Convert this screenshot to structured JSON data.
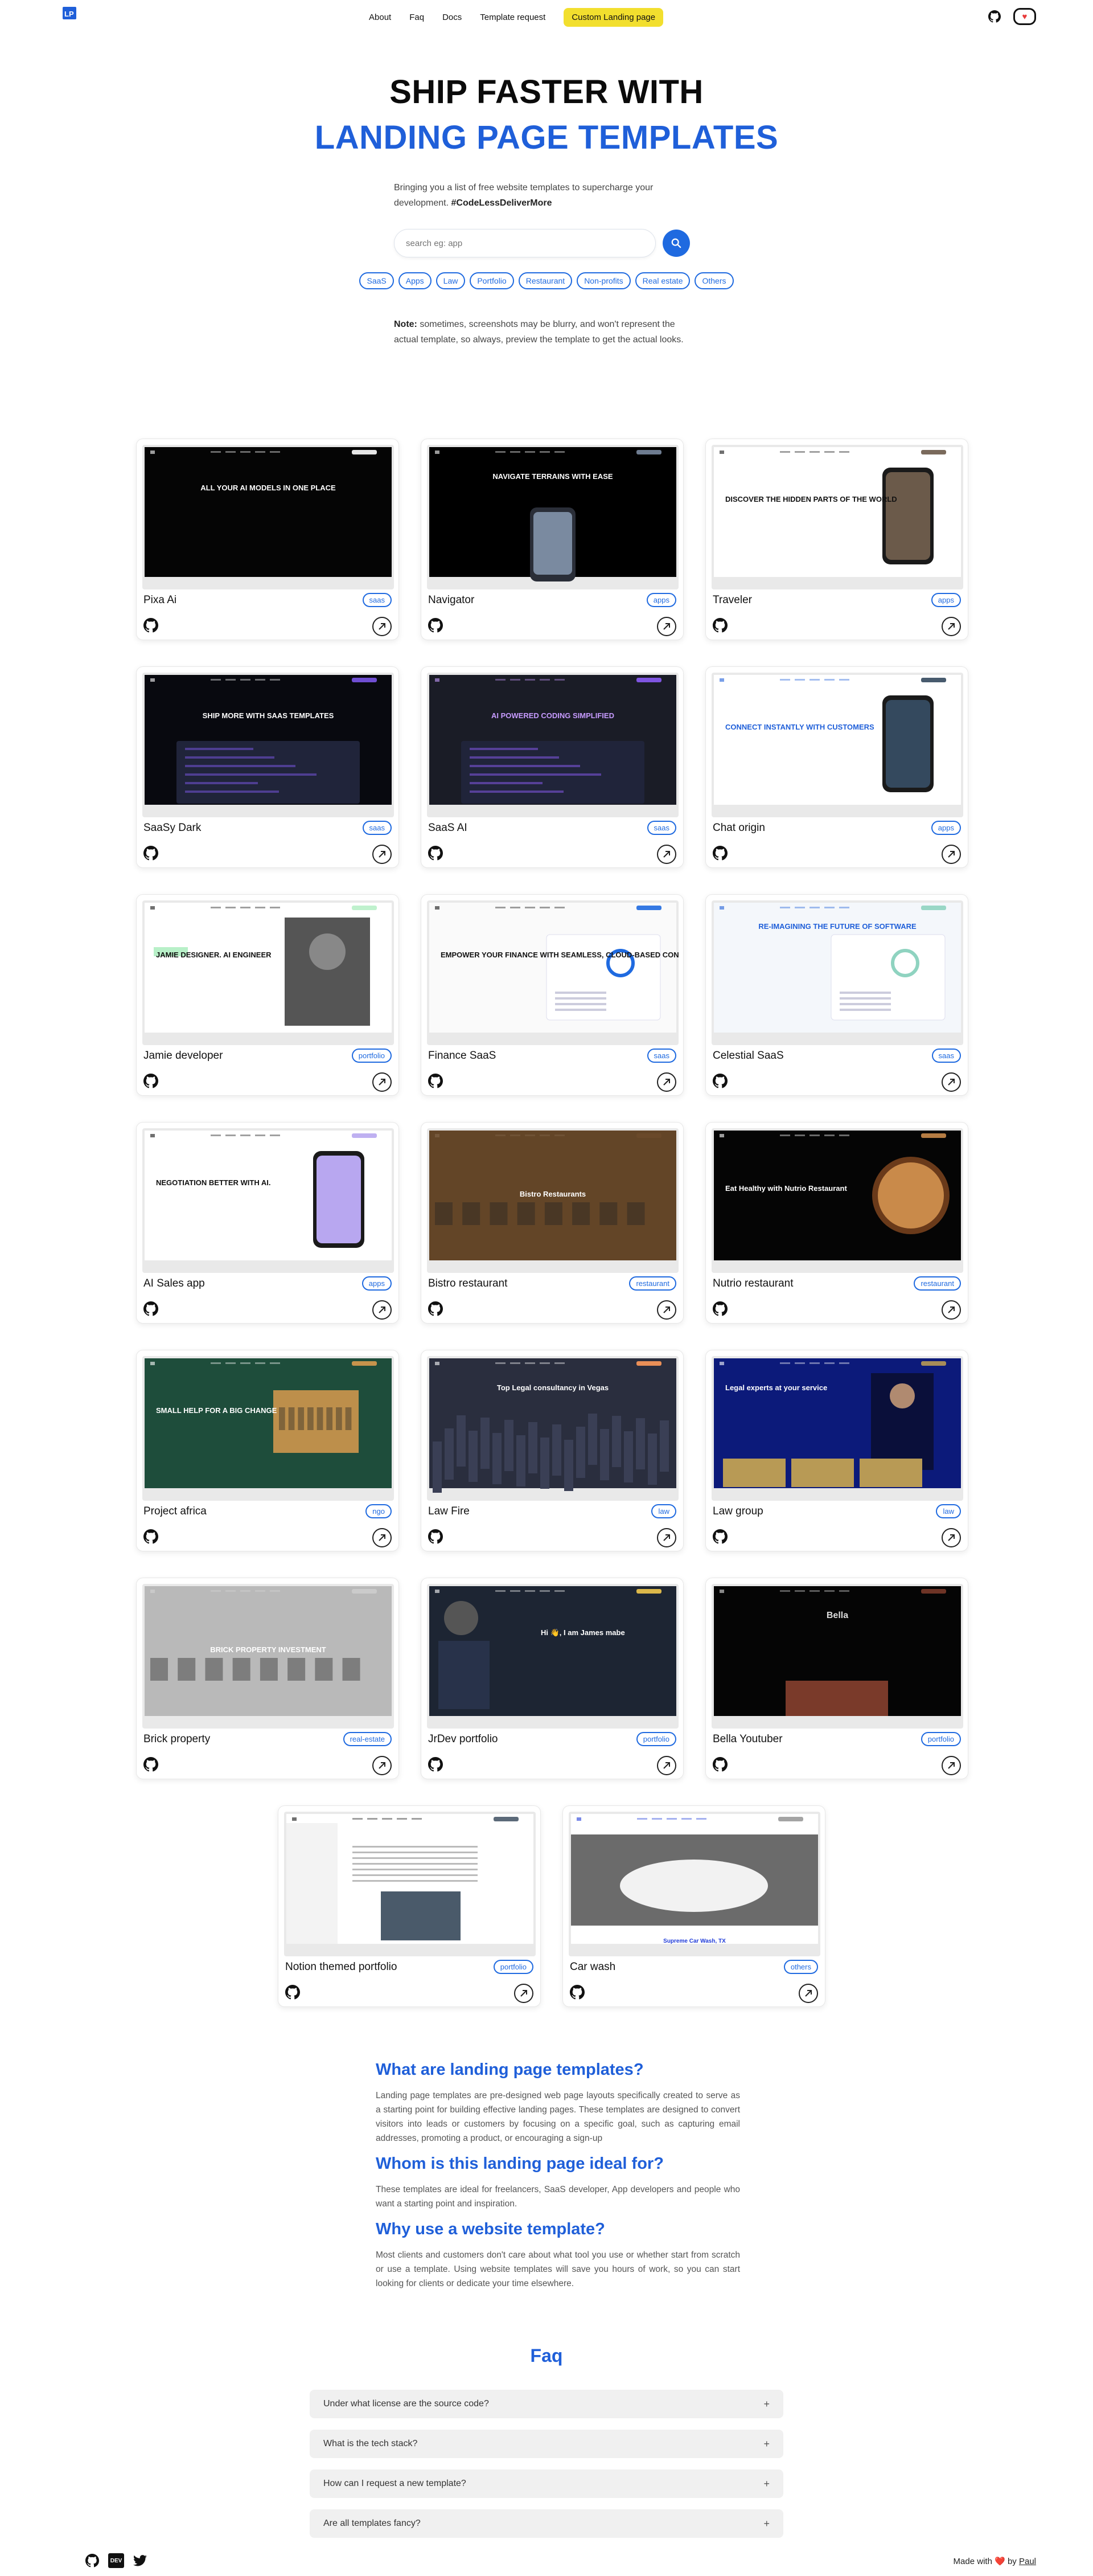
{
  "header": {
    "logo_text": "LP",
    "nav": [
      {
        "label": "About"
      },
      {
        "label": "Faq"
      },
      {
        "label": "Docs"
      },
      {
        "label": "Template request"
      }
    ],
    "cta_label": "Custom Landing page",
    "icons": [
      "github-icon",
      "kofi-icon"
    ]
  },
  "hero": {
    "title_line1": "SHIP FASTER WITH",
    "title_line2": "LANDING PAGE TEMPLATES",
    "subtitle": "Bringing you a list of free website templates to supercharge your development.",
    "hashtag": "#CodeLessDeliverMore",
    "search_placeholder": "search eg: app",
    "categories": [
      "SaaS",
      "Apps",
      "Law",
      "Portfolio",
      "Restaurant",
      "Non-profits",
      "Real estate",
      "Others"
    ],
    "note_label": "Note:",
    "note_text": "sometimes, screenshots may be blurry, and won't represent the actual template, so always, preview the template to get the actual looks."
  },
  "templates": [
    {
      "title": "Pixa Ai",
      "tag": "saas",
      "thumb_text": "ALL YOUR AI MODELS IN ONE PLACE"
    },
    {
      "title": "Navigator",
      "tag": "apps",
      "thumb_text": "NAVIGATE TERRAINS WITH EASE"
    },
    {
      "title": "Traveler",
      "tag": "apps",
      "thumb_text": "DISCOVER THE HIDDEN PARTS OF THE WORLD"
    },
    {
      "title": "SaaSy Dark",
      "tag": "saas",
      "thumb_text": "SHIP MORE WITH SAAS TEMPLATES"
    },
    {
      "title": "SaaS AI",
      "tag": "saas",
      "thumb_text": "AI POWERED CODING SIMPLIFIED"
    },
    {
      "title": "Chat origin",
      "tag": "apps",
      "thumb_text": "CONNECT INSTANTLY WITH CUSTOMERS"
    },
    {
      "title": "Jamie developer",
      "tag": "portfolio",
      "thumb_text": "JAMIE DESIGNER. AI ENGINEER"
    },
    {
      "title": "Finance SaaS",
      "tag": "saas",
      "thumb_text": "EMPOWER YOUR FINANCE WITH SEAMLESS, CLOUD-BASED CONTROL."
    },
    {
      "title": "Celestial SaaS",
      "tag": "saas",
      "thumb_text": "RE-IMAGINING THE FUTURE OF SOFTWARE"
    },
    {
      "title": "AI Sales app",
      "tag": "apps",
      "thumb_text": "NEGOTIATION BETTER WITH AI."
    },
    {
      "title": "Bistro restaurant",
      "tag": "restaurant",
      "thumb_text": "Bistro Restaurants"
    },
    {
      "title": "Nutrio restaurant",
      "tag": "restaurant",
      "thumb_text": "Eat Healthy with Nutrio Restaurant"
    },
    {
      "title": "Project africa",
      "tag": "ngo",
      "thumb_text": "SMALL HELP FOR A BIG CHANGE"
    },
    {
      "title": "Law Fire",
      "tag": "law",
      "thumb_text": "Top Legal consultancy in Vegas"
    },
    {
      "title": "Law group",
      "tag": "law",
      "thumb_text": "Legal experts at your service"
    },
    {
      "title": "Brick property",
      "tag": "real-estate",
      "thumb_text": "BRICK PROPERTY INVESTMENT"
    },
    {
      "title": "JrDev portfolio",
      "tag": "portfolio",
      "thumb_text": "Hi 👋, I am James mabe"
    },
    {
      "title": "Bella Youtuber",
      "tag": "portfolio",
      "thumb_text": "Bella"
    },
    {
      "title": "Notion themed portfolio",
      "tag": "portfolio",
      "thumb_text": ""
    },
    {
      "title": "Car wash",
      "tag": "others",
      "thumb_text": "Supreme Car Wash, TX"
    }
  ],
  "info": [
    {
      "heading": "What are landing page templates?",
      "body": "Landing page templates are pre-designed web page layouts specifically created to serve as a starting point for building effective landing pages. These templates are designed to convert visitors into leads or customers by focusing on a specific goal, such as capturing email addresses, promoting a product, or encouraging a sign-up"
    },
    {
      "heading": "Whom is this landing page ideal for?",
      "body": "These templates are ideal for freelancers, SaaS developer, App developers and people who want a starting point and inspiration."
    },
    {
      "heading": "Why use a website template?",
      "body": "Most clients and customers don't care about what tool you use or whether start from scratch or use a template. Using website templates will save you hours of work, so you can start looking for clients or dedicate your time elsewhere."
    }
  ],
  "faq": {
    "title": "Faq",
    "items": [
      {
        "question": "Under what license are the source code?",
        "symbol": "+"
      },
      {
        "question": "What is the tech stack?",
        "symbol": "+"
      },
      {
        "question": "How can I request a new template?",
        "symbol": "+"
      },
      {
        "question": "Are all templates fancy?",
        "symbol": "+"
      }
    ]
  },
  "footer": {
    "icons": [
      "github-icon",
      "dev-icon",
      "twitter-icon"
    ],
    "dev_label": "DEV",
    "made_with": "Made with",
    "heart": "❤️",
    "by": "by",
    "author": "Paul"
  },
  "colors": {
    "accent": "#1f5fd9",
    "cta": "#f2df2e"
  }
}
